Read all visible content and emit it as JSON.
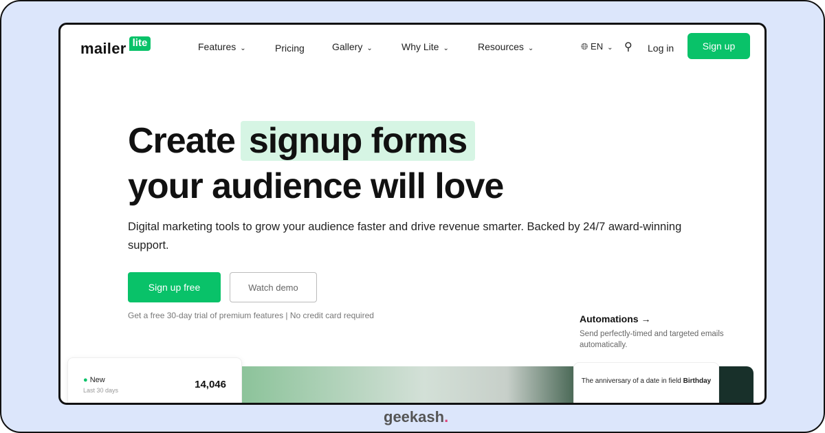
{
  "logo": {
    "main": "mailer",
    "badge": "lite"
  },
  "nav": {
    "items": [
      "Features",
      "Pricing",
      "Gallery",
      "Why Lite",
      "Resources"
    ],
    "lang": "EN",
    "login": "Log in",
    "signup": "Sign up"
  },
  "hero": {
    "title_start": "Create",
    "title_highlight": "signup forms",
    "title_line2": "your audience will love",
    "subtitle": "Digital marketing tools to grow your audience faster and drive revenue smarter. Backed by 24/7 award-winning support.",
    "cta_primary": "Sign up free",
    "cta_secondary": "Watch demo",
    "note": "Get a free 30-day trial of premium features | No credit card required"
  },
  "automations": {
    "title": "Automations →",
    "desc": "Send perfectly-timed and targeted emails automatically."
  },
  "stat": {
    "label": "New",
    "period": "Last 30 days",
    "value": "14,046"
  },
  "trigger": {
    "text": "The anniversary of a date in field",
    "field": "Birthday"
  },
  "footer_brand": {
    "name": "geekash",
    "dot": "."
  },
  "colors": {
    "accent": "#09c269",
    "highlight": "#d6f5e4",
    "frame": "#dce6fb"
  }
}
